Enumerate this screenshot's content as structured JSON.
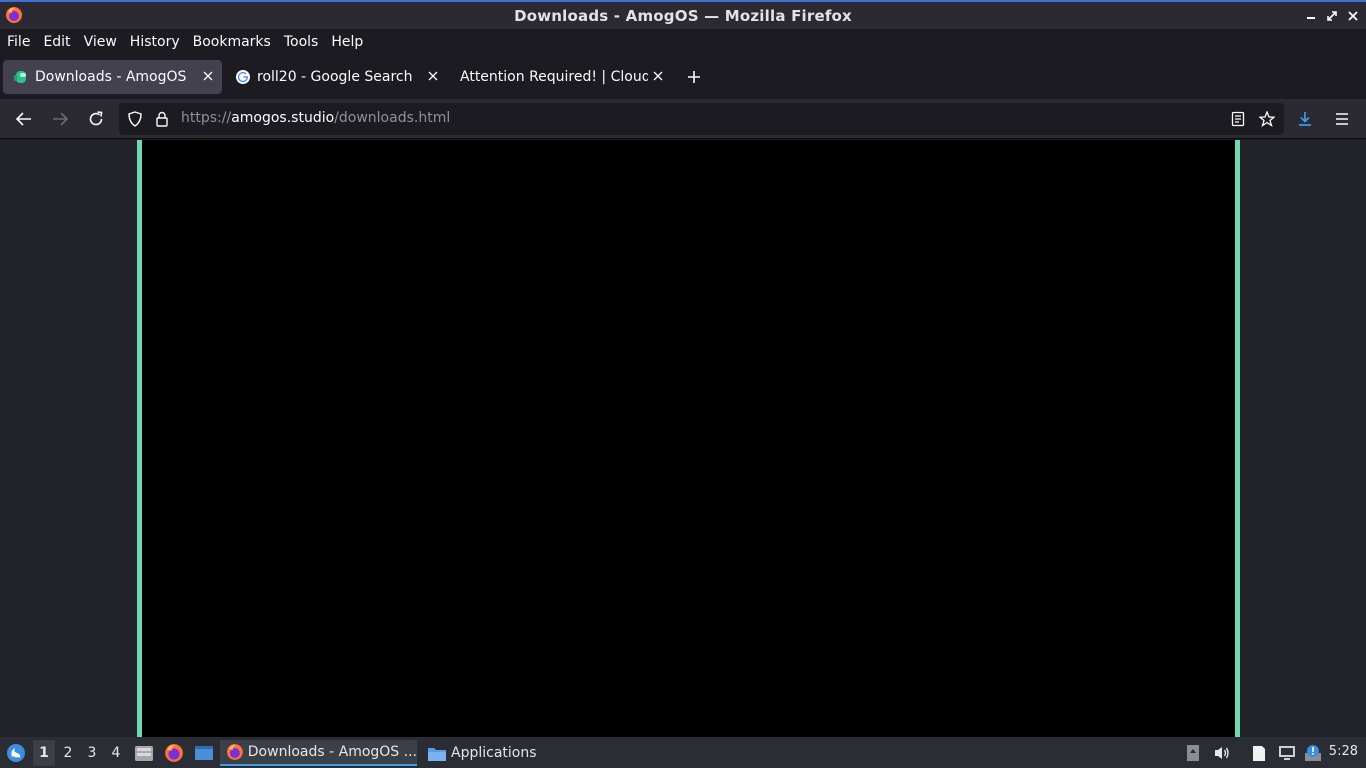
{
  "window": {
    "title": "Downloads - AmogOS — Mozilla Firefox"
  },
  "menu": {
    "items": [
      "File",
      "Edit",
      "View",
      "History",
      "Bookmarks",
      "Tools",
      "Help"
    ]
  },
  "tabs": [
    {
      "label": "Downloads - AmogOS",
      "icon": "amogos-favicon-icon",
      "active": true
    },
    {
      "label": "roll20 - Google Search",
      "icon": "google-favicon-icon",
      "active": false
    },
    {
      "label": "Attention Required! | Cloudfl",
      "icon": "none",
      "active": false
    }
  ],
  "urlbar": {
    "scheme": "https://",
    "host": "amogos.studio",
    "path": "/downloads.html"
  },
  "page": {
    "accent": "#6fd9b3",
    "stage_color": "#000000"
  },
  "taskbar": {
    "workspaces": [
      "1",
      "2",
      "3",
      "4"
    ],
    "tasks": [
      {
        "label": "Downloads - AmogOS ...",
        "icon": "firefox-icon"
      },
      {
        "label": "Applications",
        "icon": "folder-icon"
      }
    ],
    "clock": "5:28"
  },
  "colors": {
    "titlebar_accent": "#3d6fd1",
    "download_icon": "#3d9be9"
  }
}
